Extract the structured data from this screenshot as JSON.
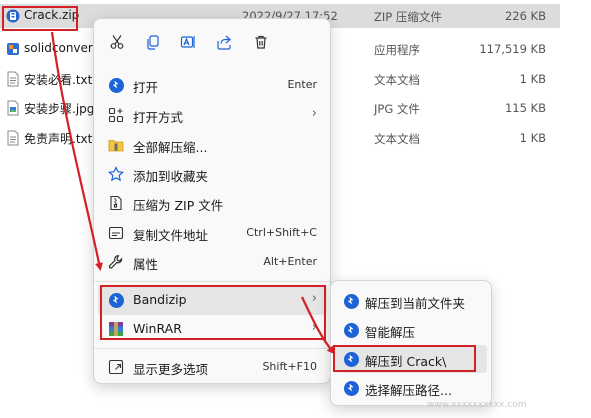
{
  "files": [
    {
      "name": "Crack.zip",
      "date": "2022/9/27 17:52",
      "type": "ZIP 压缩文件",
      "size": "226 KB",
      "icon": "zip-icon",
      "selected": true
    },
    {
      "name": "solidconverte",
      "date": "",
      "type": "应用程序",
      "size": "117,519 KB",
      "icon": "exe-icon"
    },
    {
      "name": "安装必看.txt",
      "date": "",
      "type": "文本文档",
      "size": "1 KB",
      "icon": "txt-icon"
    },
    {
      "name": "安装步骤.jpg",
      "date": "",
      "type": "JPG 文件",
      "size": "115 KB",
      "icon": "jpg-icon"
    },
    {
      "name": "免责声明.txt",
      "date": "",
      "type": "文本文档",
      "size": "1 KB",
      "icon": "txt-icon"
    }
  ],
  "context_menu": {
    "toolbar": [
      {
        "name": "cut-icon"
      },
      {
        "name": "copy-icon"
      },
      {
        "name": "rename-icon"
      },
      {
        "name": "share-icon"
      },
      {
        "name": "delete-icon"
      }
    ],
    "items": [
      {
        "label": "打开",
        "shortcut": "Enter",
        "icon": "open-icon"
      },
      {
        "label": "打开方式",
        "shortcut": "",
        "icon": "open-with-icon",
        "submenu": true
      },
      {
        "label": "全部解压缩...",
        "shortcut": "",
        "icon": "extract-all-icon"
      },
      {
        "label": "添加到收藏夹",
        "shortcut": "",
        "icon": "star-icon"
      },
      {
        "label": "压缩为 ZIP 文件",
        "shortcut": "",
        "icon": "compress-zip-icon"
      },
      {
        "label": "复制文件地址",
        "shortcut": "Ctrl+Shift+C",
        "icon": "copy-path-icon"
      },
      {
        "label": "属性",
        "shortcut": "Alt+Enter",
        "icon": "wrench-icon"
      }
    ],
    "archivers": [
      {
        "label": "Bandizip",
        "icon": "bandizip-icon",
        "submenu": true
      },
      {
        "label": "WinRAR",
        "icon": "winrar-icon",
        "submenu": true
      }
    ],
    "more": {
      "label": "显示更多选项",
      "shortcut": "Shift+F10",
      "icon": "more-options-icon"
    }
  },
  "submenu": {
    "items": [
      {
        "label": "解压到当前文件夹",
        "icon": "bandizip-icon"
      },
      {
        "label": "智能解压",
        "icon": "bandizip-icon"
      },
      {
        "label": "解压到 Crack\\",
        "icon": "bandizip-icon"
      },
      {
        "label": "选择解压路径...",
        "icon": "bandizip-icon"
      }
    ]
  },
  "watermark": "www.xxxxxxxxxx.com",
  "colors": {
    "highlight_red": "#d32027",
    "accent_blue": "#1b63d6",
    "selected_bg": "#dcdcdc"
  }
}
